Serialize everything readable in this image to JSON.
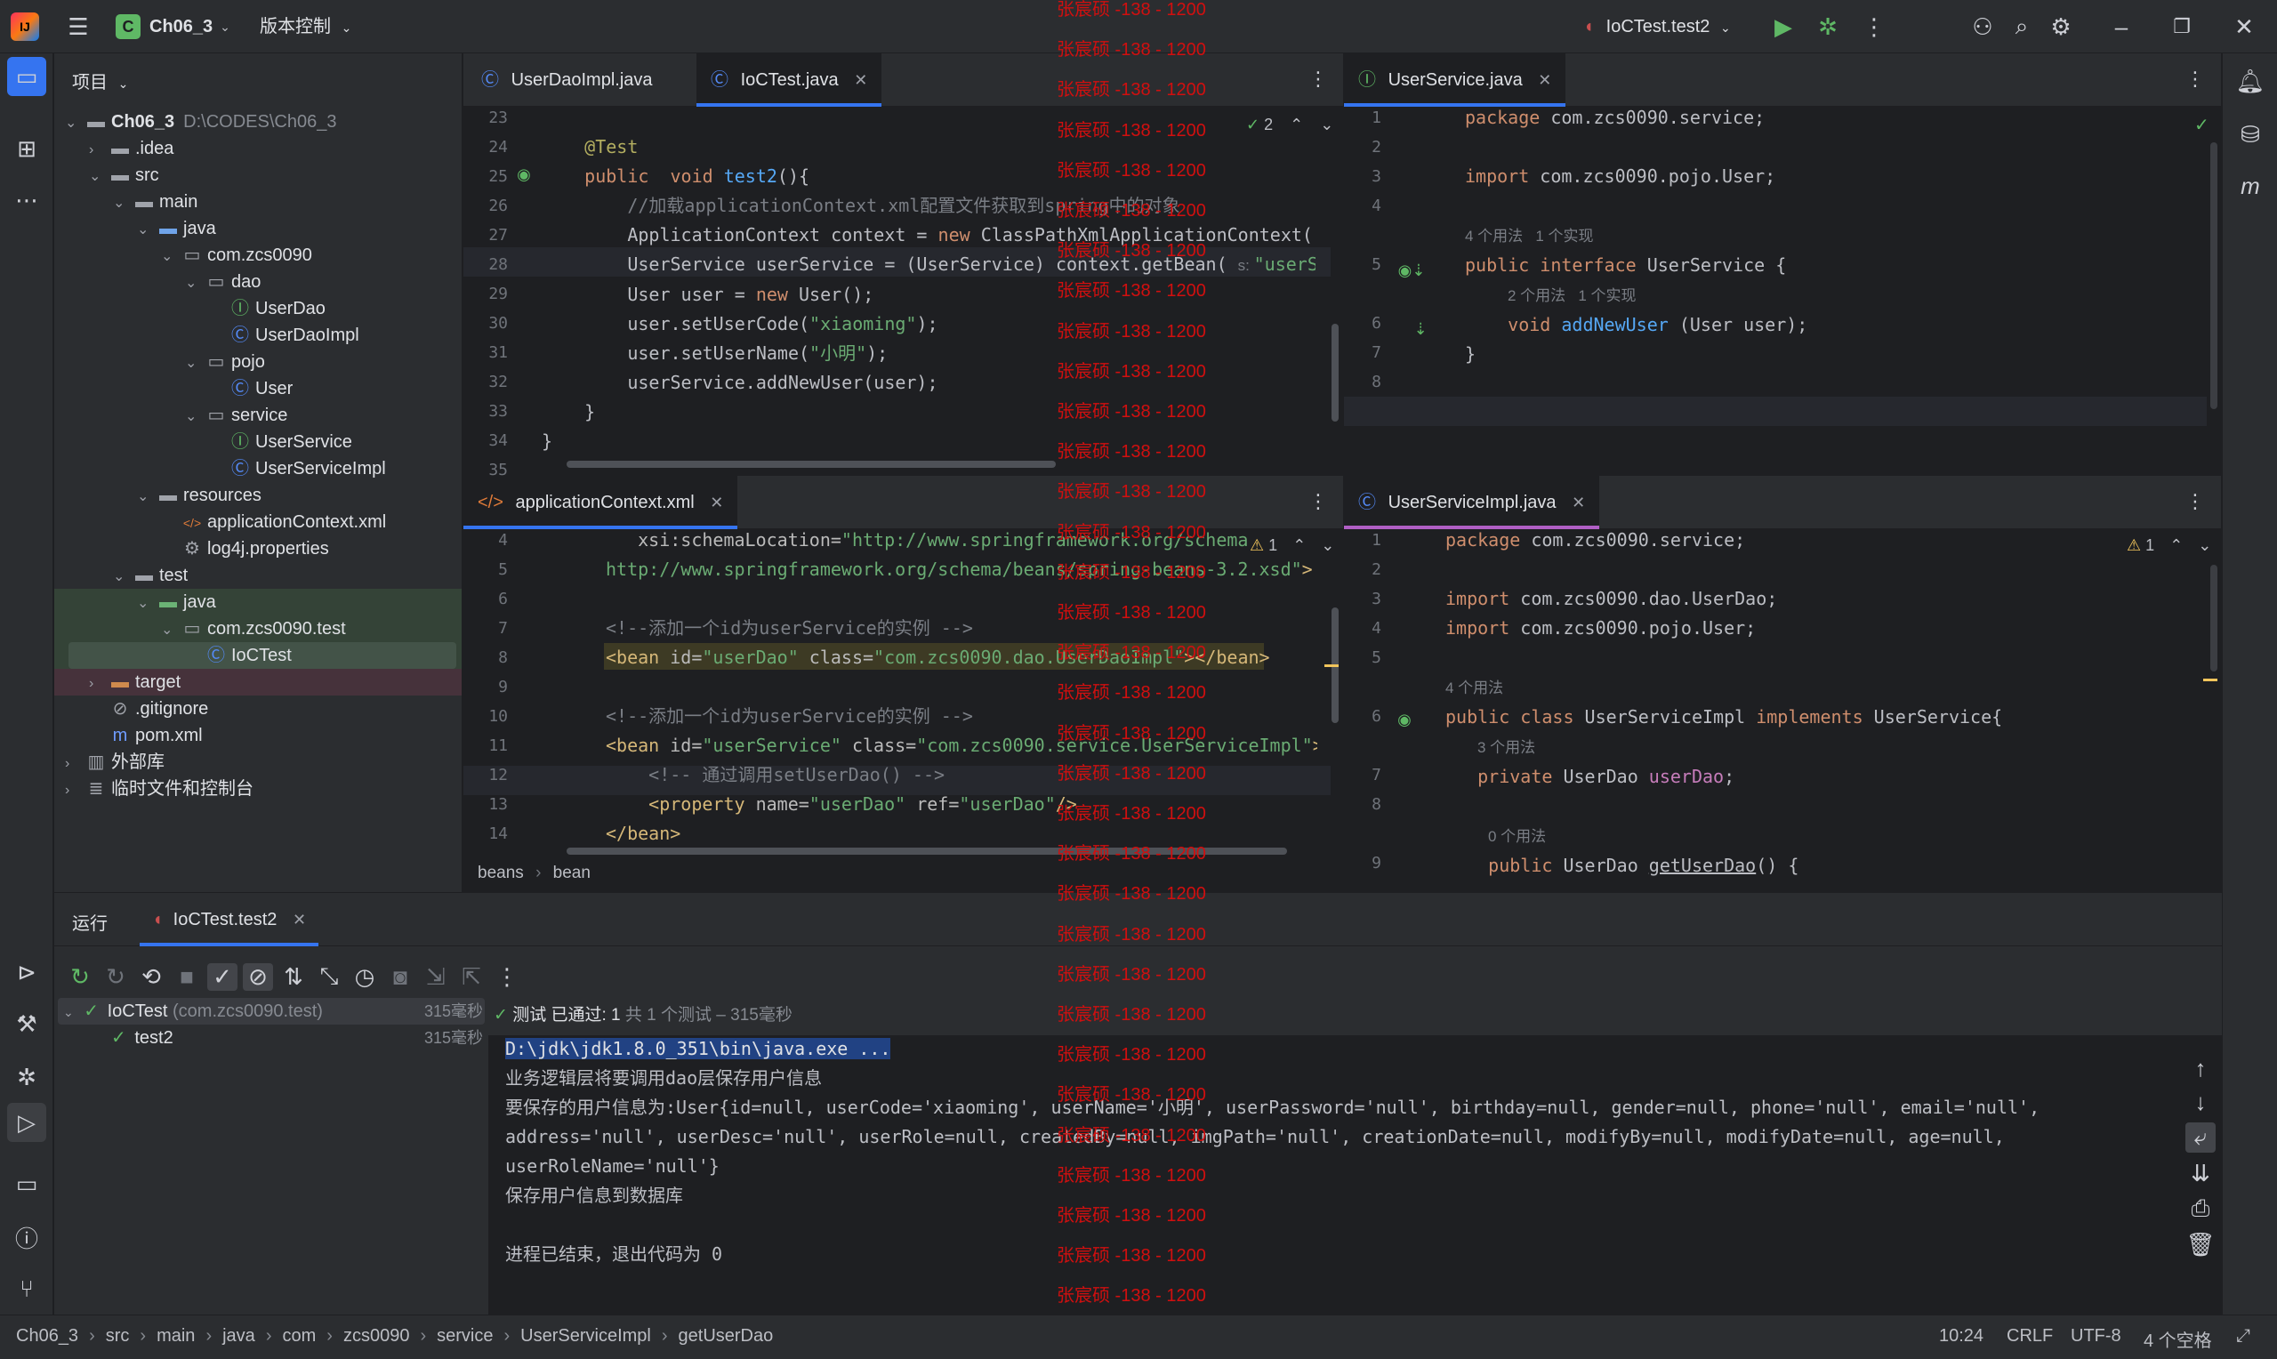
{
  "titlebar": {
    "project_badge": "C",
    "project": "Ch06_3",
    "vcs": "版本控制",
    "run_config": "IoCTest.test2"
  },
  "project_panel": {
    "title": "项目",
    "items": [
      {
        "label": "Ch06_3",
        "extra": "D:\\CODES\\Ch06_3",
        "depth": 0,
        "arrow": "v",
        "icon": "folder-icon"
      },
      {
        "label": ".idea",
        "depth": 1,
        "arrow": ">",
        "icon": "folder-icon"
      },
      {
        "label": "src",
        "depth": 1,
        "arrow": "v",
        "icon": "folder-icon"
      },
      {
        "label": "main",
        "depth": 2,
        "arrow": "v",
        "icon": "folder-icon"
      },
      {
        "label": "java",
        "depth": 3,
        "arrow": "v",
        "icon": "source-folder-icon"
      },
      {
        "label": "com.zcs0090",
        "depth": 4,
        "arrow": "v",
        "icon": "package-icon"
      },
      {
        "label": "dao",
        "depth": 5,
        "arrow": "v",
        "icon": "package-icon"
      },
      {
        "label": "UserDao",
        "depth": 6,
        "arrow": "",
        "icon": "interface-icon"
      },
      {
        "label": "UserDaoImpl",
        "depth": 6,
        "arrow": "",
        "icon": "class-icon"
      },
      {
        "label": "pojo",
        "depth": 5,
        "arrow": "v",
        "icon": "package-icon"
      },
      {
        "label": "User",
        "depth": 6,
        "arrow": "",
        "icon": "class-icon"
      },
      {
        "label": "service",
        "depth": 5,
        "arrow": "v",
        "icon": "package-icon"
      },
      {
        "label": "UserService",
        "depth": 6,
        "arrow": "",
        "icon": "interface-icon"
      },
      {
        "label": "UserServiceImpl",
        "depth": 6,
        "arrow": "",
        "icon": "class-icon"
      },
      {
        "label": "resources",
        "depth": 3,
        "arrow": "v",
        "icon": "resources-folder-icon"
      },
      {
        "label": "applicationContext.xml",
        "depth": 4,
        "arrow": "",
        "icon": "xml-file-icon"
      },
      {
        "label": "log4j.properties",
        "depth": 4,
        "arrow": "",
        "icon": "properties-file-icon"
      },
      {
        "label": "test",
        "depth": 2,
        "arrow": "v",
        "icon": "folder-icon"
      },
      {
        "label": "java",
        "depth": 3,
        "arrow": "v",
        "icon": "test-folder-icon"
      },
      {
        "label": "com.zcs0090.test",
        "depth": 4,
        "arrow": "v",
        "icon": "package-icon"
      },
      {
        "label": "IoCTest",
        "depth": 5,
        "arrow": "",
        "icon": "class-icon"
      },
      {
        "label": "target",
        "depth": 1,
        "arrow": ">",
        "icon": "excluded-folder-icon"
      },
      {
        "label": ".gitignore",
        "depth": 1,
        "arrow": "",
        "icon": "ignore-file-icon"
      },
      {
        "label": "pom.xml",
        "depth": 1,
        "arrow": "",
        "icon": "maven-icon"
      },
      {
        "label": "外部库",
        "depth": 0,
        "arrow": ">",
        "icon": "library-icon"
      },
      {
        "label": "临时文件和控制台",
        "depth": 0,
        "arrow": ">",
        "icon": "scratch-icon"
      }
    ]
  },
  "editor_tl": {
    "tabs": [
      "UserDaoImpl.java",
      "IoCTest.java"
    ],
    "inspection": "2",
    "line_numbers": [
      "23",
      "24",
      "25",
      "26",
      "27",
      "28",
      "29",
      "30",
      "31",
      "32",
      "33",
      "34",
      "35"
    ]
  },
  "editor_tr": {
    "tabs": [
      "UserService.java"
    ],
    "line_numbers": [
      "1",
      "2",
      "3",
      "4",
      "",
      "5",
      "",
      "6",
      "7",
      "8"
    ],
    "usage_hint_1": "4 个用法   1 个实现",
    "usage_hint_2": "2 个用法   1 个实现"
  },
  "editor_bl": {
    "tabs": [
      "applicationContext.xml"
    ],
    "warnings": "1",
    "line_numbers": [
      "4",
      "5",
      "6",
      "7",
      "8",
      "9",
      "10",
      "11",
      "12",
      "13",
      "14"
    ],
    "breadcrumb": [
      "beans",
      "bean"
    ]
  },
  "editor_br": {
    "tabs": [
      "UserServiceImpl.java"
    ],
    "warnings": "1",
    "line_numbers": [
      "1",
      "2",
      "3",
      "4",
      "5",
      "",
      "6",
      "",
      "7",
      "8",
      "",
      "9"
    ],
    "usage_hint_1": "4 个用法",
    "usage_hint_2": "3 个用法",
    "usage_hint_3": "0 个用法"
  },
  "run": {
    "label": "运行",
    "tab": "IoCTest.test2",
    "tree": [
      {
        "label": "IoCTest",
        "pkg": "(com.zcs0090.test)",
        "time": "315毫秒"
      },
      {
        "label": "test2",
        "pkg": "",
        "time": "315毫秒"
      }
    ],
    "summary_pass": "测试 已通过: 1",
    "summary_rest": "共 1 个测试 – 315毫秒",
    "console": [
      "D:\\jdk\\jdk1.8.0_351\\bin\\java.exe ...",
      "业务逻辑层将要调用dao层保存用户信息",
      "要保存的用户信息为:User{id=null, userCode='xiaoming', userName='小明', userPassword='null', birthday=null, gender=null, phone='null', email='null',",
      "address='null', userDesc='null', userRole=null, createdBy=null, imgPath='null', creationDate=null, modifyBy=null, modifyDate=null, age=null,",
      "userRoleName='null'}",
      "保存用户信息到数据库",
      "",
      "进程已结束，退出代码为 0"
    ]
  },
  "statusbar": {
    "crumbs": [
      "Ch06_3",
      "src",
      "main",
      "java",
      "com",
      "zcs0090",
      "service",
      "UserServiceImpl",
      "getUserDao"
    ],
    "position": "10:24",
    "line_sep": "CRLF",
    "encoding": "UTF-8",
    "indent": "4 个空格"
  },
  "watermark": "张宸硕 -138 - 1200"
}
